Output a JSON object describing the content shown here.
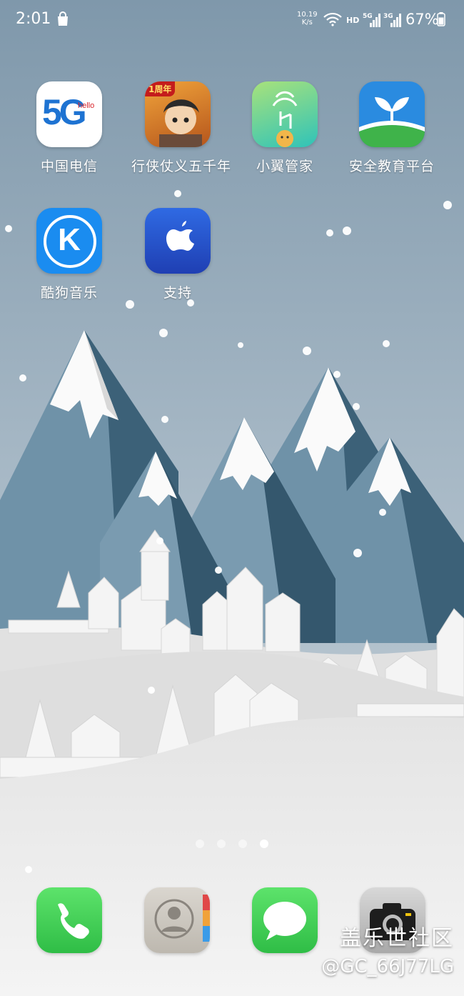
{
  "status_bar": {
    "time": "2:01",
    "net_speed_value": "10.19",
    "net_speed_unit": "K/s",
    "hd_label": "HD",
    "signal1_label": "5G",
    "signal2_label": "3G",
    "battery_percent": "67%"
  },
  "home_apps": [
    {
      "label": "中国电信",
      "icon_text": "5G",
      "icon_subtext": "hello"
    },
    {
      "label": "行侠仗义五千年",
      "icon_text": "1周年"
    },
    {
      "label": "小翼管家"
    },
    {
      "label": "安全教育平台"
    },
    {
      "label": "酷狗音乐",
      "icon_text": "K"
    },
    {
      "label": "支持"
    }
  ],
  "page_indicator": {
    "count": 4,
    "active_index": 3
  },
  "dock": [
    {
      "name": "phone",
      "icon": "phone-icon"
    },
    {
      "name": "contacts",
      "icon": "contacts-icon"
    },
    {
      "name": "messages",
      "icon": "message-icon"
    },
    {
      "name": "camera",
      "icon": "camera-icon"
    }
  ],
  "watermark": {
    "line1": "盖乐世社区",
    "line2": "@GC_66J77LG"
  },
  "colors": {
    "sky_top": "#7f98ab",
    "sky_bottom": "#b7c5cf",
    "mountain_light": "#6f92a8",
    "mountain_dark": "#33566c",
    "snow": "#f2f2f2",
    "kugou_blue": "#1a8cf0",
    "support_blue": "#2a5bd7",
    "phone_green": "#34c759"
  }
}
